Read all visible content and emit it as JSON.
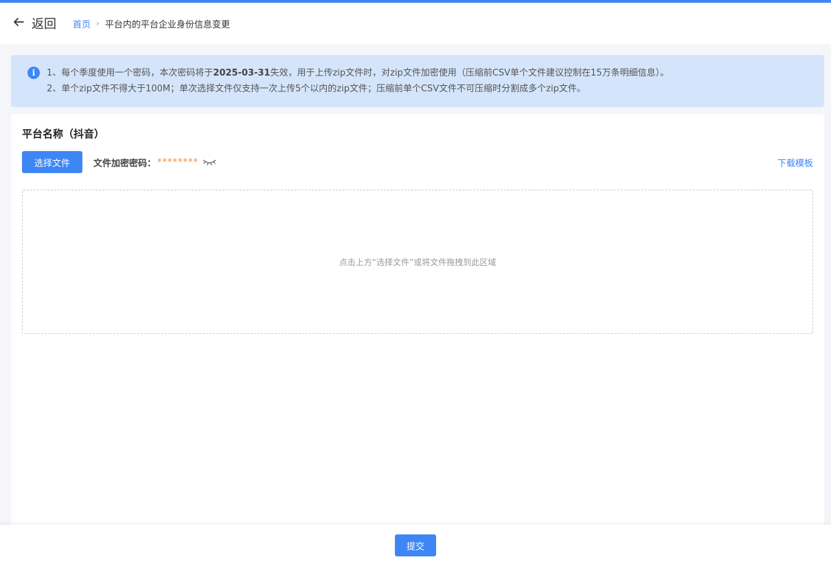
{
  "header": {
    "back_label": "返回",
    "breadcrumb": {
      "home": "首页",
      "separator": "›",
      "current": "平台内的平台企业身份信息变更"
    }
  },
  "notice": {
    "line1_prefix": "1、每个季度使用一个密码，本次密码将于",
    "line1_date": "2025-03-31",
    "line1_suffix": "失效，用于上传zip文件时，对zip文件加密使用（压缩前CSV单个文件建议控制在15万条明细信息）。",
    "line2": "2、单个zip文件不得大于100M；单次选择文件仅支持一次上传5个以内的zip文件；压缩前单个CSV文件不可压缩时分割成多个zip文件。"
  },
  "panel": {
    "platform_title": "平台名称（抖音）",
    "select_file_label": "选择文件",
    "password_label": "文件加密密码：",
    "password_value": "********",
    "download_template_label": "下载模板",
    "dropzone_hint": "点击上方“选择文件”或将文件拖拽到此区域"
  },
  "footer": {
    "submit_label": "提交"
  },
  "colors": {
    "accent": "#3e86f5",
    "notice_bg": "#d4e5fb",
    "password_color": "#f0883a"
  },
  "icons": {
    "back": "arrow-left-icon",
    "info": "info-icon",
    "eye": "eye-closed-icon"
  }
}
